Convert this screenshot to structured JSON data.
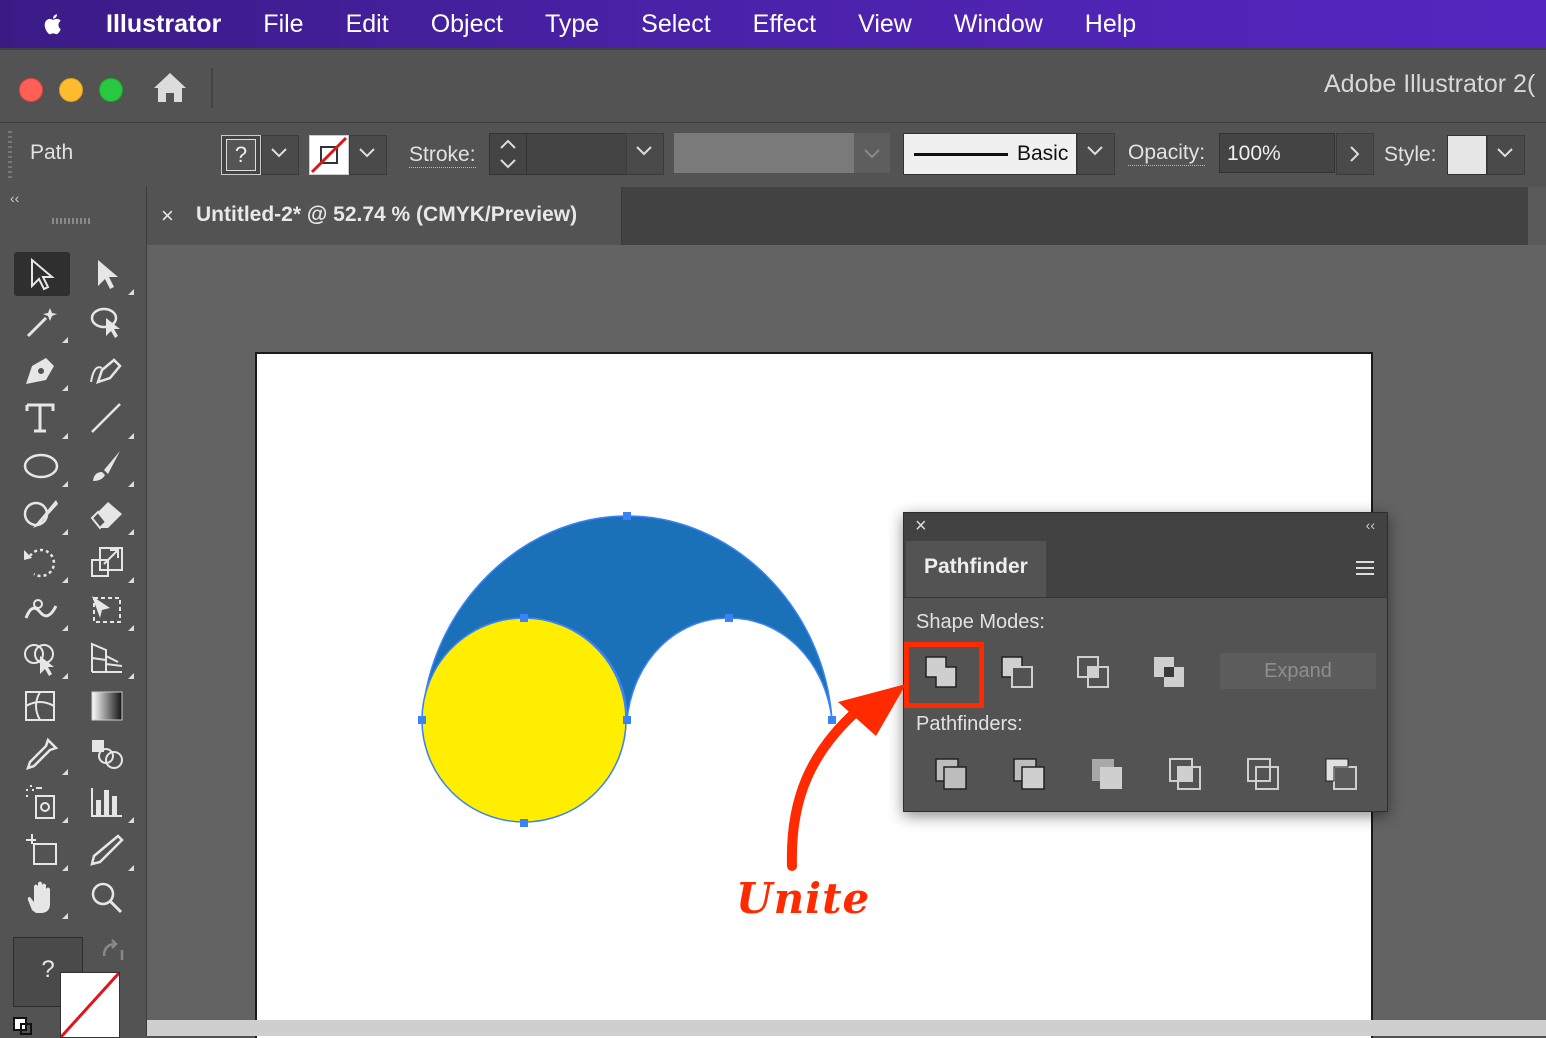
{
  "menubar": {
    "app_name": "Illustrator",
    "items": [
      "File",
      "Edit",
      "Object",
      "Type",
      "Select",
      "Effect",
      "View",
      "Window",
      "Help"
    ]
  },
  "window": {
    "title": "Adobe Illustrator 2("
  },
  "controlbar": {
    "selection_label": "Path",
    "fill_swatch_glyph": "?",
    "stroke_label": "Stroke:",
    "stroke_weight": "",
    "brush_preset": "Basic",
    "opacity_label": "Opacity:",
    "opacity_value": "100%",
    "style_label": "Style:"
  },
  "document_tab": {
    "close_glyph": "×",
    "title": "Untitled-2* @ 52.74 % (CMYK/Preview)"
  },
  "toolbar": {
    "collapse_glyph": "‹‹",
    "fill_glyph": "?"
  },
  "pathfinder": {
    "close_glyph": "×",
    "collapse_glyph": "‹‹",
    "tab_label": "Pathfinder",
    "shape_modes_label": "Shape Modes:",
    "expand_label": "Expand",
    "pathfinders_label": "Pathfinders:"
  },
  "annotation": {
    "callout_text": "Unite",
    "color": "#ff2a00"
  },
  "colors": {
    "shape_blue": "#1b71b8",
    "shape_yellow": "#ffee00",
    "anchor_blue": "#3b82f6"
  }
}
